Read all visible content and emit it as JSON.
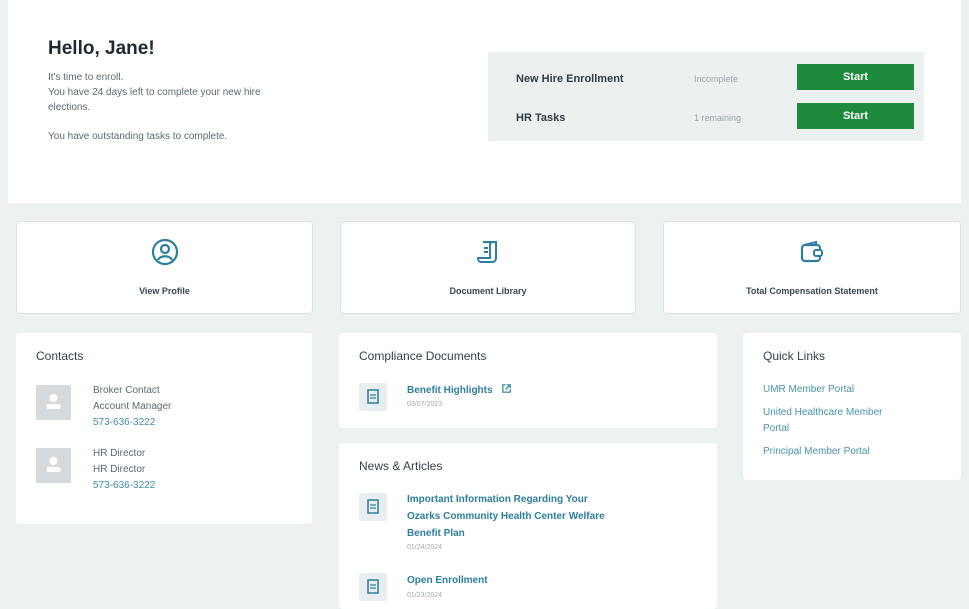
{
  "hero": {
    "title": "Hello, Jane!",
    "line1": "It's time to enroll.",
    "line2": "You have 24 days left to complete your new hire",
    "line3": "elections.",
    "line4": "You have outstanding tasks to complete."
  },
  "tasks": [
    {
      "name": "New Hire Enrollment",
      "status": "Incomplete",
      "button": "Start"
    },
    {
      "name": "HR Tasks",
      "status": "1 remaining",
      "button": "Start"
    }
  ],
  "tiles": [
    {
      "label": "View Profile",
      "icon": "profile-icon"
    },
    {
      "label": "Document Library",
      "icon": "document-scroll-icon"
    },
    {
      "label": "Total Compensation Statement",
      "icon": "wallet-icon"
    }
  ],
  "contacts": {
    "title": "Contacts",
    "items": [
      {
        "name": "Broker Contact",
        "role": "Account Manager",
        "phone": "573-636-3222"
      },
      {
        "name": "HR Director",
        "role": "HR Director",
        "phone": "573-636-3222"
      }
    ]
  },
  "compliance": {
    "title": "Compliance Documents",
    "items": [
      {
        "title": "Benefit Highlights",
        "date": "03/07/2023",
        "icon": "external-link-icon"
      }
    ]
  },
  "news": {
    "title": "News & Articles",
    "items": [
      {
        "line1": "Important Information Regarding Your",
        "line2": "Ozarks Community Health Center Welfare",
        "line3": "Benefit Plan",
        "date": "01/24/2024"
      },
      {
        "line1": "Open Enrollment",
        "date": "01/23/2024"
      }
    ]
  },
  "quick_links": {
    "title": "Quick Links",
    "items": [
      {
        "line1": "UMR Member Portal"
      },
      {
        "line1": "United Healthcare Member",
        "line2": "Portal"
      },
      {
        "line1": "Principal Member Portal"
      }
    ]
  },
  "colors": {
    "accent_green": "#1d8a3c",
    "link_blue": "#2e7f9c",
    "background": "#eef1f2"
  }
}
